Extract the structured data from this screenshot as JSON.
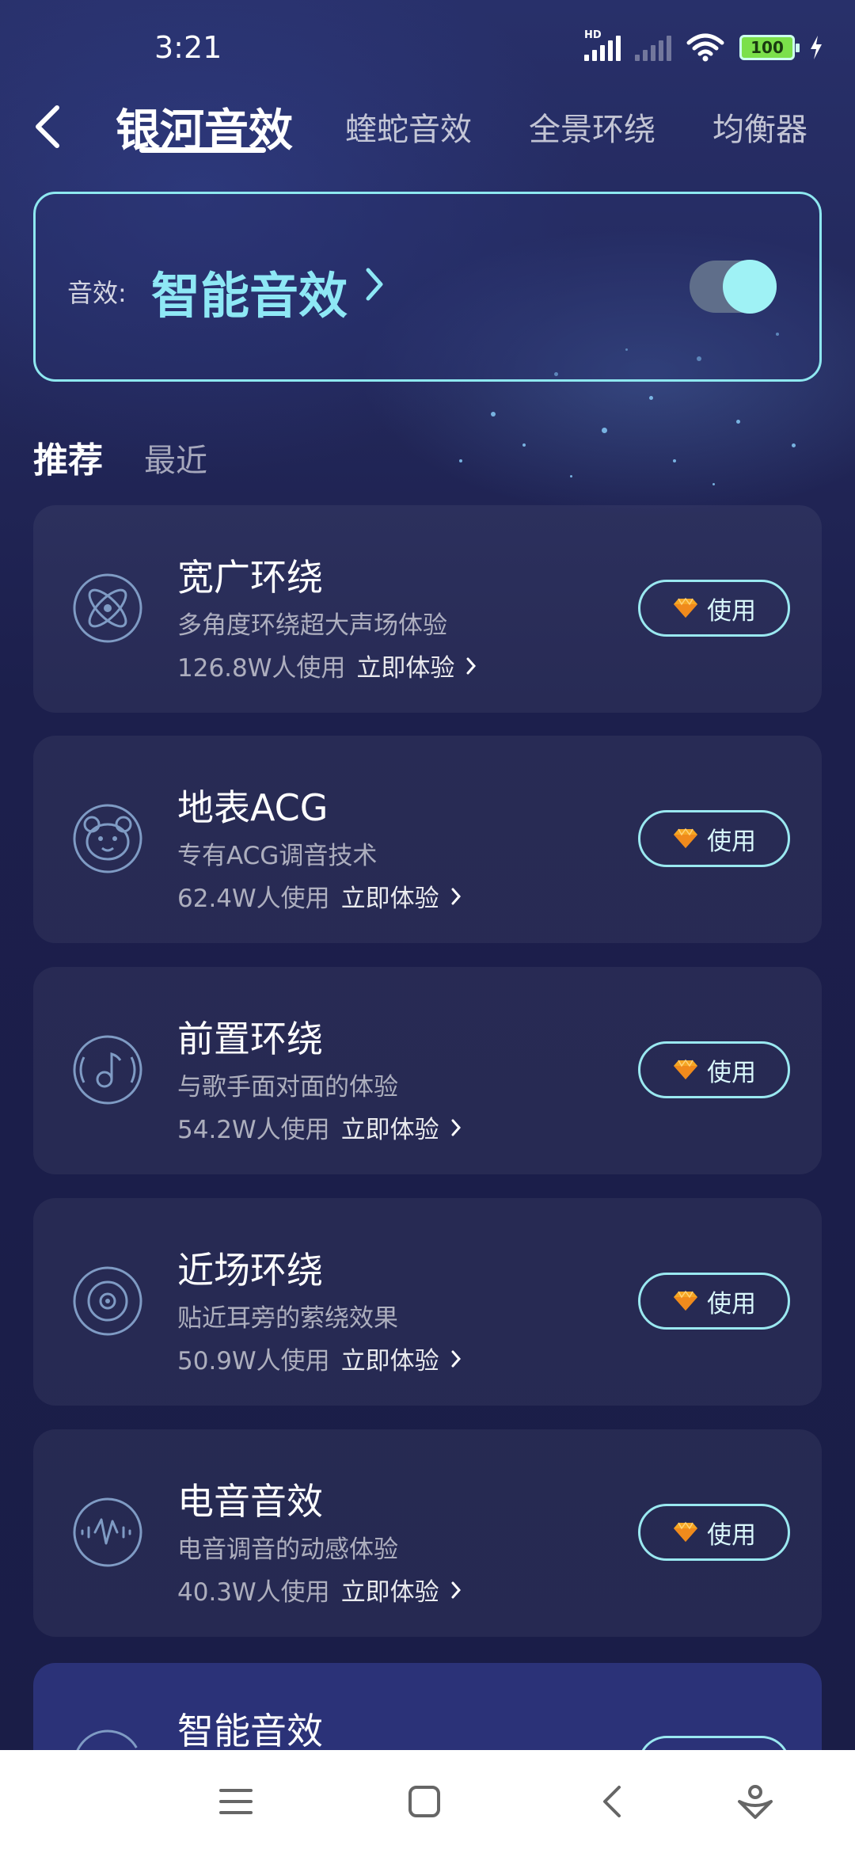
{
  "status_bar": {
    "time": "3:21",
    "hd_label": "HD",
    "battery": "100"
  },
  "header": {
    "tabs": [
      {
        "label": "银河音效",
        "active": true
      },
      {
        "label": "蝰蛇音效",
        "active": false
      },
      {
        "label": "全景环绕",
        "active": false
      },
      {
        "label": "均衡器",
        "active": false
      }
    ]
  },
  "effect_panel": {
    "label": "音效:",
    "current": "智能音效",
    "enabled": true
  },
  "section_tabs": {
    "recommended": "推荐",
    "recent": "最近"
  },
  "effects": [
    {
      "title": "宽广环绕",
      "desc": "多角度环绕超大声场体验",
      "count": "126.8W人使用",
      "try": "立即体验",
      "button": "使用",
      "icon": "atom-icon"
    },
    {
      "title": "地表ACG",
      "desc": "专有ACG调音技术",
      "count": "62.4W人使用",
      "try": "立即体验",
      "button": "使用",
      "icon": "bear-face-icon"
    },
    {
      "title": "前置环绕",
      "desc": "与歌手面对面的体验",
      "count": "54.2W人使用",
      "try": "立即体验",
      "button": "使用",
      "icon": "music-note-icon"
    },
    {
      "title": "近场环绕",
      "desc": "贴近耳旁的萦绕效果",
      "count": "50.9W人使用",
      "try": "立即体验",
      "button": "使用",
      "icon": "speaker-icon"
    },
    {
      "title": "电音音效",
      "desc": "电音调音的动感体验",
      "count": "40.3W人使用",
      "try": "立即体验",
      "button": "使用",
      "icon": "electronic-wave-icon"
    },
    {
      "title": "智能音效",
      "icon": "smart-effect-icon"
    }
  ],
  "nav_bar": {
    "buttons": [
      "menu-icon",
      "home-icon",
      "back-icon",
      "assistant-icon"
    ]
  },
  "colors": {
    "accent": "#8ee8f5",
    "background": "#1a1d45",
    "premium": "#f5a623"
  }
}
